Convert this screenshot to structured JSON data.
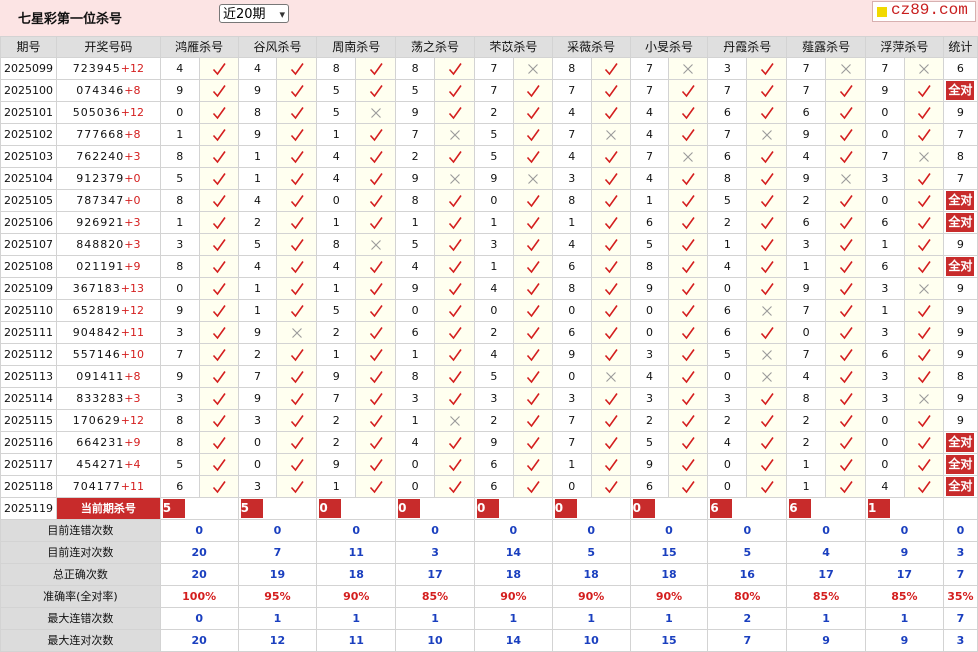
{
  "header": {
    "title": "七星彩第一位杀号",
    "range_select": "近20期",
    "site_logo": "cz89.com"
  },
  "columns": [
    "期号",
    "开奖号码",
    "鸿雁杀号",
    "谷风杀号",
    "周南杀号",
    "荡之杀号",
    "芣苡杀号",
    "采薇杀号",
    "小旻杀号",
    "丹霞杀号",
    "薤露杀号",
    "浮萍杀号",
    "统计"
  ],
  "rows": [
    {
      "period": "2025099",
      "digits": "723945",
      "bonus": "+12",
      "picks": [
        [
          4,
          1
        ],
        [
          4,
          1
        ],
        [
          8,
          1
        ],
        [
          8,
          1
        ],
        [
          7,
          0
        ],
        [
          8,
          1
        ],
        [
          7,
          0
        ],
        [
          3,
          1
        ],
        [
          7,
          0
        ],
        [
          7,
          0
        ]
      ],
      "stat": "6"
    },
    {
      "period": "2025100",
      "digits": "074346",
      "bonus": "+8",
      "picks": [
        [
          9,
          1
        ],
        [
          9,
          1
        ],
        [
          5,
          1
        ],
        [
          5,
          1
        ],
        [
          7,
          1
        ],
        [
          7,
          1
        ],
        [
          7,
          1
        ],
        [
          7,
          1
        ],
        [
          7,
          1
        ],
        [
          9,
          1
        ]
      ],
      "stat": "全对"
    },
    {
      "period": "2025101",
      "digits": "505036",
      "bonus": "+12",
      "picks": [
        [
          0,
          1
        ],
        [
          8,
          1
        ],
        [
          5,
          0
        ],
        [
          9,
          1
        ],
        [
          2,
          1
        ],
        [
          4,
          1
        ],
        [
          4,
          1
        ],
        [
          6,
          1
        ],
        [
          6,
          1
        ],
        [
          0,
          1
        ]
      ],
      "stat": "9"
    },
    {
      "period": "2025102",
      "digits": "777668",
      "bonus": "+8",
      "picks": [
        [
          1,
          1
        ],
        [
          9,
          1
        ],
        [
          1,
          1
        ],
        [
          7,
          0
        ],
        [
          5,
          1
        ],
        [
          7,
          0
        ],
        [
          4,
          1
        ],
        [
          7,
          0
        ],
        [
          9,
          1
        ],
        [
          0,
          1
        ]
      ],
      "stat": "7"
    },
    {
      "period": "2025103",
      "digits": "762240",
      "bonus": "+3",
      "picks": [
        [
          8,
          1
        ],
        [
          1,
          1
        ],
        [
          4,
          1
        ],
        [
          2,
          1
        ],
        [
          5,
          1
        ],
        [
          4,
          1
        ],
        [
          7,
          0
        ],
        [
          6,
          1
        ],
        [
          4,
          1
        ],
        [
          7,
          0
        ]
      ],
      "stat": "8"
    },
    {
      "period": "2025104",
      "digits": "912379",
      "bonus": "+0",
      "picks": [
        [
          5,
          1
        ],
        [
          1,
          1
        ],
        [
          4,
          1
        ],
        [
          9,
          0
        ],
        [
          9,
          0
        ],
        [
          3,
          1
        ],
        [
          4,
          1
        ],
        [
          8,
          1
        ],
        [
          9,
          0
        ],
        [
          3,
          1
        ]
      ],
      "stat": "7"
    },
    {
      "period": "2025105",
      "digits": "787347",
      "bonus": "+0",
      "picks": [
        [
          8,
          1
        ],
        [
          4,
          1
        ],
        [
          0,
          1
        ],
        [
          8,
          1
        ],
        [
          0,
          1
        ],
        [
          8,
          1
        ],
        [
          1,
          1
        ],
        [
          5,
          1
        ],
        [
          2,
          1
        ],
        [
          0,
          1
        ]
      ],
      "stat": "全对"
    },
    {
      "period": "2025106",
      "digits": "926921",
      "bonus": "+3",
      "picks": [
        [
          1,
          1
        ],
        [
          2,
          1
        ],
        [
          1,
          1
        ],
        [
          1,
          1
        ],
        [
          1,
          1
        ],
        [
          1,
          1
        ],
        [
          6,
          1
        ],
        [
          2,
          1
        ],
        [
          6,
          1
        ],
        [
          6,
          1
        ]
      ],
      "stat": "全对"
    },
    {
      "period": "2025107",
      "digits": "848820",
      "bonus": "+3",
      "picks": [
        [
          3,
          1
        ],
        [
          5,
          1
        ],
        [
          8,
          0
        ],
        [
          5,
          1
        ],
        [
          3,
          1
        ],
        [
          4,
          1
        ],
        [
          5,
          1
        ],
        [
          1,
          1
        ],
        [
          3,
          1
        ],
        [
          1,
          1
        ]
      ],
      "stat": "9"
    },
    {
      "period": "2025108",
      "digits": "021191",
      "bonus": "+9",
      "picks": [
        [
          8,
          1
        ],
        [
          4,
          1
        ],
        [
          4,
          1
        ],
        [
          4,
          1
        ],
        [
          1,
          1
        ],
        [
          6,
          1
        ],
        [
          8,
          1
        ],
        [
          4,
          1
        ],
        [
          1,
          1
        ],
        [
          6,
          1
        ]
      ],
      "stat": "全对"
    },
    {
      "period": "2025109",
      "digits": "367183",
      "bonus": "+13",
      "picks": [
        [
          0,
          1
        ],
        [
          1,
          1
        ],
        [
          1,
          1
        ],
        [
          9,
          1
        ],
        [
          4,
          1
        ],
        [
          8,
          1
        ],
        [
          9,
          1
        ],
        [
          0,
          1
        ],
        [
          9,
          1
        ],
        [
          3,
          0
        ]
      ],
      "stat": "9"
    },
    {
      "period": "2025110",
      "digits": "652819",
      "bonus": "+12",
      "picks": [
        [
          9,
          1
        ],
        [
          1,
          1
        ],
        [
          5,
          1
        ],
        [
          0,
          1
        ],
        [
          0,
          1
        ],
        [
          0,
          1
        ],
        [
          0,
          1
        ],
        [
          6,
          0
        ],
        [
          7,
          1
        ],
        [
          1,
          1
        ]
      ],
      "stat": "9"
    },
    {
      "period": "2025111",
      "digits": "904842",
      "bonus": "+11",
      "picks": [
        [
          3,
          1
        ],
        [
          9,
          0
        ],
        [
          2,
          1
        ],
        [
          6,
          1
        ],
        [
          2,
          1
        ],
        [
          6,
          1
        ],
        [
          0,
          1
        ],
        [
          6,
          1
        ],
        [
          0,
          1
        ],
        [
          3,
          1
        ]
      ],
      "stat": "9"
    },
    {
      "period": "2025112",
      "digits": "557146",
      "bonus": "+10",
      "picks": [
        [
          7,
          1
        ],
        [
          2,
          1
        ],
        [
          1,
          1
        ],
        [
          1,
          1
        ],
        [
          4,
          1
        ],
        [
          9,
          1
        ],
        [
          3,
          1
        ],
        [
          5,
          0
        ],
        [
          7,
          1
        ],
        [
          6,
          1
        ]
      ],
      "stat": "9"
    },
    {
      "period": "2025113",
      "digits": "091411",
      "bonus": "+8",
      "picks": [
        [
          9,
          1
        ],
        [
          7,
          1
        ],
        [
          9,
          1
        ],
        [
          8,
          1
        ],
        [
          5,
          1
        ],
        [
          0,
          0
        ],
        [
          4,
          1
        ],
        [
          0,
          0
        ],
        [
          4,
          1
        ],
        [
          3,
          1
        ]
      ],
      "stat": "8"
    },
    {
      "period": "2025114",
      "digits": "833283",
      "bonus": "+3",
      "picks": [
        [
          3,
          1
        ],
        [
          9,
          1
        ],
        [
          7,
          1
        ],
        [
          3,
          1
        ],
        [
          3,
          1
        ],
        [
          3,
          1
        ],
        [
          3,
          1
        ],
        [
          3,
          1
        ],
        [
          8,
          1
        ],
        [
          3,
          0
        ]
      ],
      "stat": "9"
    },
    {
      "period": "2025115",
      "digits": "170629",
      "bonus": "+12",
      "picks": [
        [
          8,
          1
        ],
        [
          3,
          1
        ],
        [
          2,
          1
        ],
        [
          1,
          0
        ],
        [
          2,
          1
        ],
        [
          7,
          1
        ],
        [
          2,
          1
        ],
        [
          2,
          1
        ],
        [
          2,
          1
        ],
        [
          0,
          1
        ]
      ],
      "stat": "9"
    },
    {
      "period": "2025116",
      "digits": "664231",
      "bonus": "+9",
      "picks": [
        [
          8,
          1
        ],
        [
          0,
          1
        ],
        [
          2,
          1
        ],
        [
          4,
          1
        ],
        [
          9,
          1
        ],
        [
          7,
          1
        ],
        [
          5,
          1
        ],
        [
          4,
          1
        ],
        [
          2,
          1
        ],
        [
          0,
          1
        ]
      ],
      "stat": "全对"
    },
    {
      "period": "2025117",
      "digits": "454271",
      "bonus": "+4",
      "picks": [
        [
          5,
          1
        ],
        [
          0,
          1
        ],
        [
          9,
          1
        ],
        [
          0,
          1
        ],
        [
          6,
          1
        ],
        [
          1,
          1
        ],
        [
          9,
          1
        ],
        [
          0,
          1
        ],
        [
          1,
          1
        ],
        [
          0,
          1
        ]
      ],
      "stat": "全对"
    },
    {
      "period": "2025118",
      "digits": "704177",
      "bonus": "+11",
      "picks": [
        [
          6,
          1
        ],
        [
          3,
          1
        ],
        [
          1,
          1
        ],
        [
          0,
          1
        ],
        [
          6,
          1
        ],
        [
          0,
          1
        ],
        [
          6,
          1
        ],
        [
          0,
          1
        ],
        [
          1,
          1
        ],
        [
          4,
          1
        ]
      ],
      "stat": "全对"
    }
  ],
  "current": {
    "period": "2025119",
    "label": "当前期杀号",
    "values": [
      5,
      5,
      0,
      0,
      0,
      0,
      0,
      6,
      6,
      1
    ]
  },
  "stats": [
    {
      "label": "目前连错次数",
      "values": [
        "0",
        "0",
        "0",
        "0",
        "0",
        "0",
        "0",
        "0",
        "0",
        "0",
        "0"
      ],
      "red": false
    },
    {
      "label": "目前连对次数",
      "values": [
        "20",
        "7",
        "11",
        "3",
        "14",
        "5",
        "15",
        "5",
        "4",
        "9",
        "3"
      ],
      "red": false
    },
    {
      "label": "总正确次数",
      "values": [
        "20",
        "19",
        "18",
        "17",
        "18",
        "18",
        "18",
        "16",
        "17",
        "17",
        "7"
      ],
      "red": false
    },
    {
      "label": "准确率(全对率)",
      "values": [
        "100%",
        "95%",
        "90%",
        "85%",
        "90%",
        "90%",
        "90%",
        "80%",
        "85%",
        "85%",
        "35%"
      ],
      "red": true
    },
    {
      "label": "最大连错次数",
      "values": [
        "0",
        "1",
        "1",
        "1",
        "1",
        "1",
        "1",
        "2",
        "1",
        "1",
        "7"
      ],
      "red": false
    },
    {
      "label": "最大连对次数",
      "values": [
        "20",
        "12",
        "11",
        "10",
        "14",
        "10",
        "15",
        "7",
        "9",
        "9",
        "3"
      ],
      "red": false
    }
  ],
  "colors": {
    "tick": "#d41e1e",
    "cross": "#9a9a9a",
    "badge": "#c82b2b",
    "stat_value": "#1a3fbf"
  }
}
